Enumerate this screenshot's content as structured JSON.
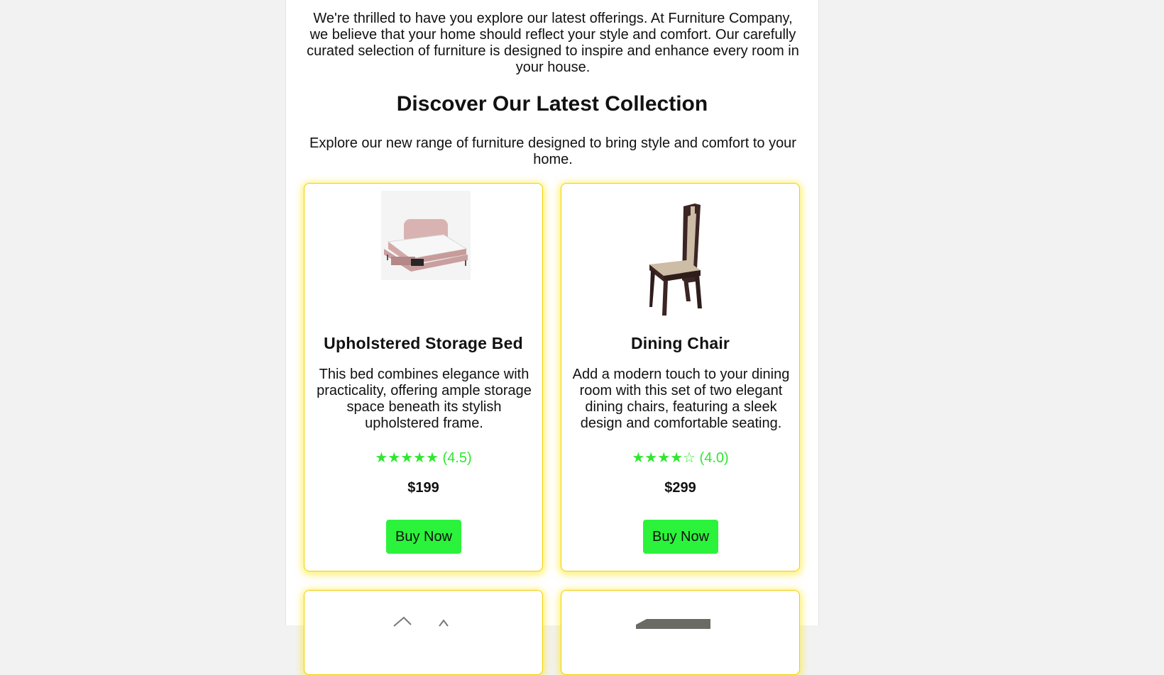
{
  "intro": {
    "text": "We're thrilled to have you explore our latest offerings. At Furniture Company, we believe that your home should reflect your style and comfort. Our carefully curated selection of furniture is designed to inspire and enhance every room in your house."
  },
  "collection": {
    "title": "Discover Our Latest Collection",
    "subtitle": "Explore our new range of furniture designed to bring style and comfort to your home."
  },
  "products": [
    {
      "name": "Upholstered Storage Bed",
      "description": "This bed combines elegance with practicality, offering ample storage space beneath its stylish upholstered frame.",
      "stars": "★★★★★",
      "rating_text": "(4.5)",
      "rating": 4.5,
      "price": "$199",
      "button_label": "Buy Now",
      "image_icon": "bed-image"
    },
    {
      "name": "Dining Chair",
      "description": "Add a modern touch to your dining room with this set of two elegant dining chairs, featuring a sleek design and comfortable seating.",
      "stars": "★★★★☆",
      "rating_text": "(4.0)",
      "rating": 4.0,
      "price": "$299",
      "button_label": "Buy Now",
      "image_icon": "chair-image"
    }
  ],
  "colors": {
    "accent_green": "#2bf33b",
    "star_green": "#2ee82e",
    "card_glow_yellow": "#ffe600",
    "page_background": "#f2f2f2"
  }
}
